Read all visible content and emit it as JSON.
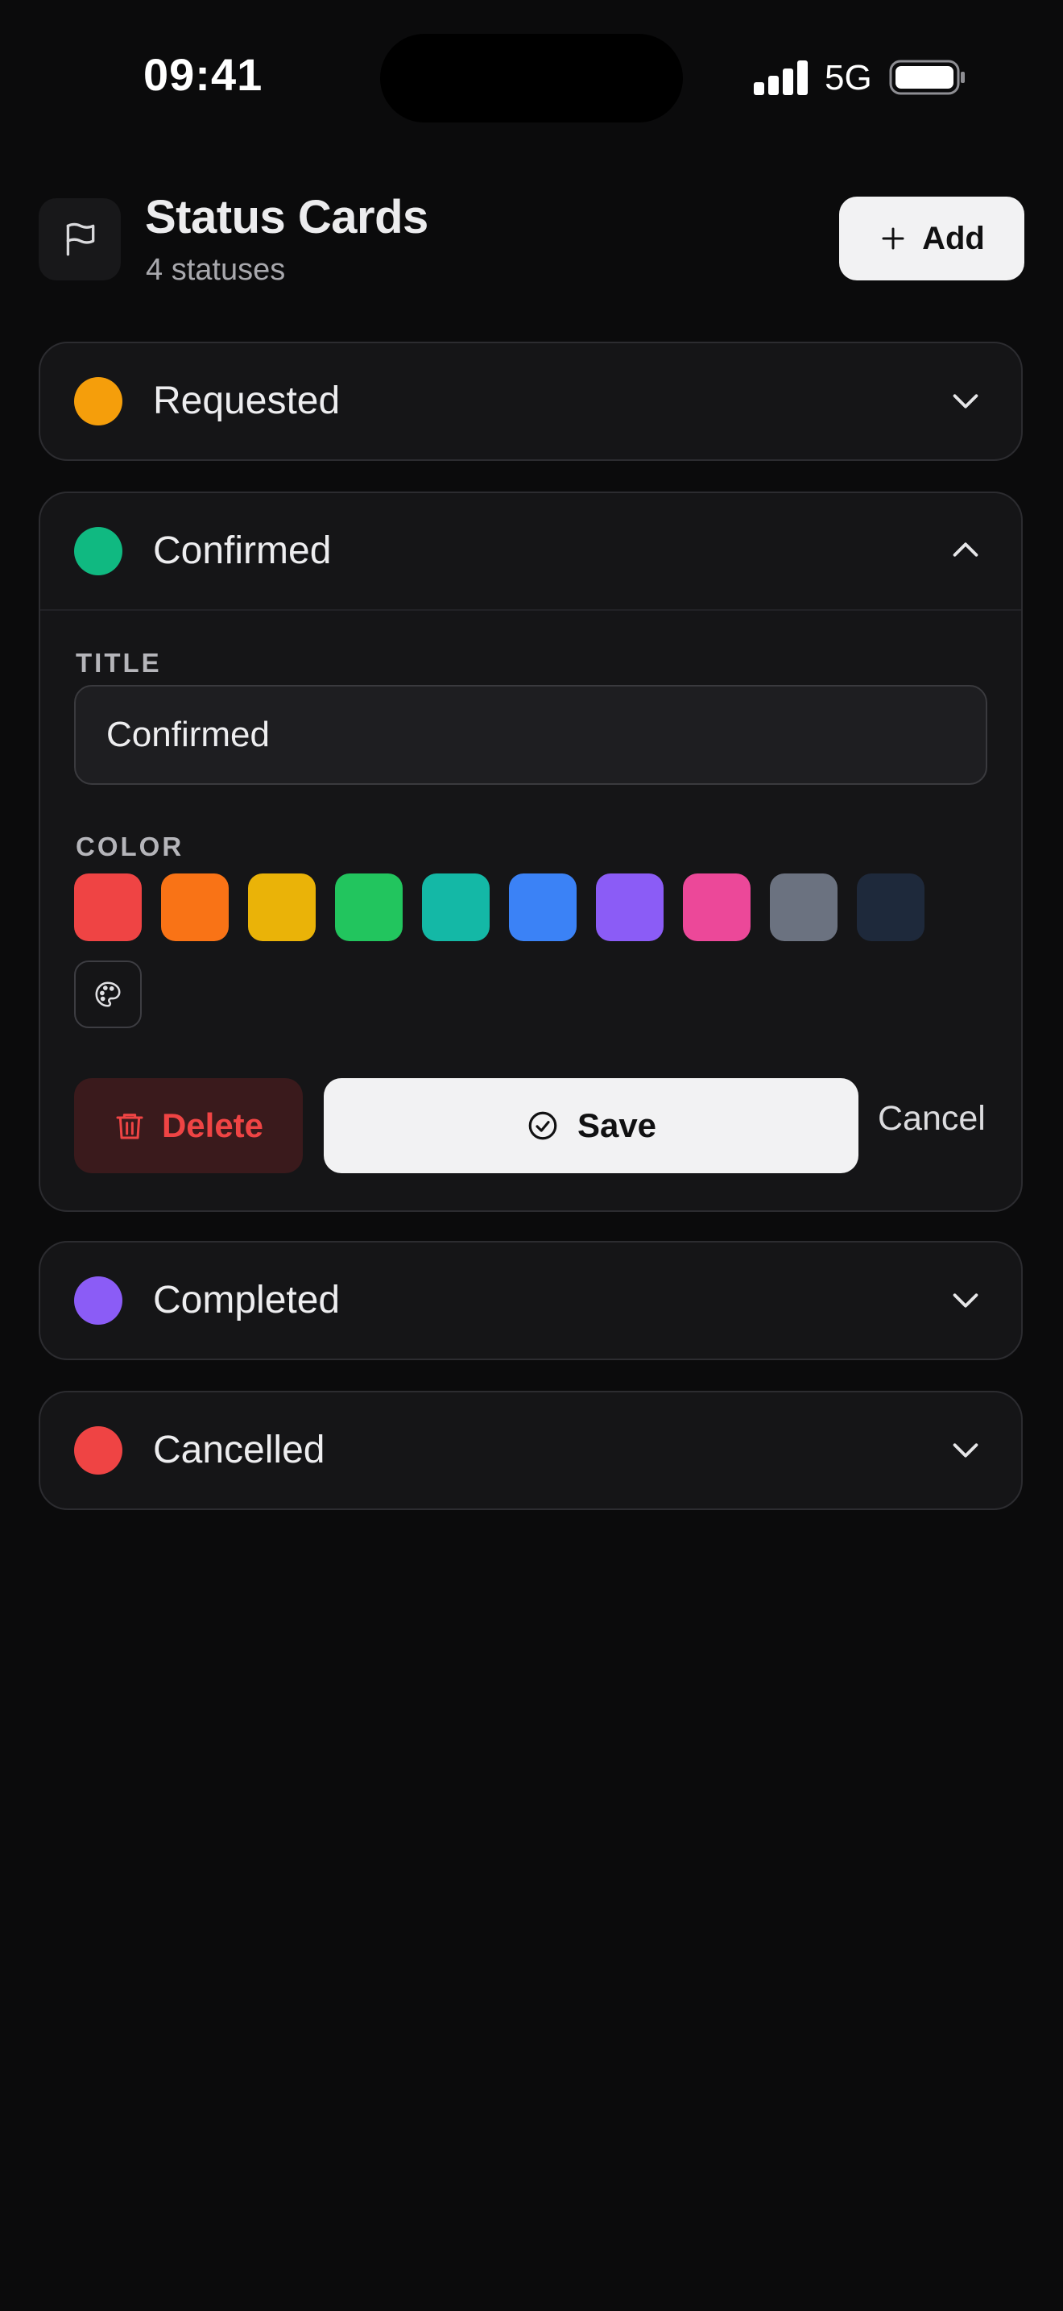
{
  "status_bar": {
    "time": "09:41",
    "network": "5G"
  },
  "header": {
    "title": "Status Cards",
    "subtitle": "4 statuses",
    "add_label": "Add"
  },
  "statuses": [
    {
      "label": "Requested",
      "color": "#f59e0b",
      "expanded": false
    },
    {
      "label": "Confirmed",
      "color": "#10b981",
      "expanded": true
    },
    {
      "label": "Completed",
      "color": "#8b5cf6",
      "expanded": false
    },
    {
      "label": "Cancelled",
      "color": "#ef4444",
      "expanded": false
    }
  ],
  "editor": {
    "title_label": "TITLE",
    "title_value": "Confirmed",
    "color_label": "COLOR",
    "palette": [
      "#ef4444",
      "#f97316",
      "#eab308",
      "#22c55e",
      "#14b8a6",
      "#3b82f6",
      "#8b5cf6",
      "#ec4899",
      "#6b7280",
      "#1e293b"
    ],
    "delete_label": "Delete",
    "save_label": "Save",
    "cancel_label": "Cancel"
  }
}
